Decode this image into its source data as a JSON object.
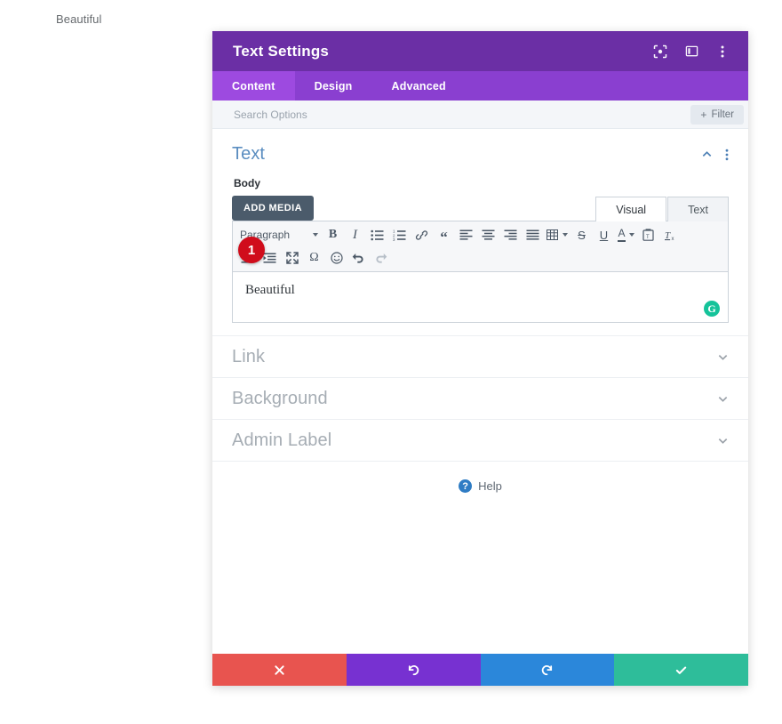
{
  "page": {
    "background_text": "Beautiful"
  },
  "modal": {
    "title": "Text Settings",
    "header_icons": [
      {
        "name": "focus-icon"
      },
      {
        "name": "layout-panel-icon"
      },
      {
        "name": "more-vertical-icon"
      }
    ],
    "tabs": [
      {
        "label": "Content",
        "active": true
      },
      {
        "label": "Design",
        "active": false
      },
      {
        "label": "Advanced",
        "active": false
      }
    ],
    "search": {
      "placeholder": "Search Options",
      "value": ""
    },
    "filter_button": {
      "label": "Filter",
      "plus": "+"
    },
    "section_text": {
      "title": "Text",
      "field_label": "Body",
      "add_media_label": "ADD MEDIA",
      "editor_tabs": [
        {
          "label": "Visual",
          "active": true
        },
        {
          "label": "Text",
          "active": false
        }
      ],
      "toolbar": {
        "format_select": "Paragraph",
        "row1": [
          {
            "name": "bold-icon",
            "glyph": "B"
          },
          {
            "name": "italic-icon",
            "glyph": "I"
          },
          {
            "name": "bulleted-list-icon",
            "glyph": ""
          },
          {
            "name": "numbered-list-icon",
            "glyph": ""
          },
          {
            "name": "link-icon",
            "glyph": ""
          },
          {
            "name": "blockquote-icon",
            "glyph": "“"
          },
          {
            "name": "align-left-icon",
            "glyph": ""
          },
          {
            "name": "align-center-icon",
            "glyph": ""
          },
          {
            "name": "align-right-icon",
            "glyph": ""
          },
          {
            "name": "align-justify-icon",
            "glyph": ""
          },
          {
            "name": "table-icon",
            "glyph": ""
          },
          {
            "name": "strikethrough-icon",
            "glyph": "S"
          },
          {
            "name": "underline-icon",
            "glyph": "U"
          },
          {
            "name": "text-color-icon",
            "glyph": "A"
          },
          {
            "name": "paste-as-text-icon",
            "glyph": ""
          },
          {
            "name": "clear-formatting-icon",
            "glyph": ""
          }
        ],
        "row2": [
          {
            "name": "decrease-indent-icon",
            "glyph": ""
          },
          {
            "name": "increase-indent-icon",
            "glyph": ""
          },
          {
            "name": "fullscreen-icon",
            "glyph": ""
          },
          {
            "name": "special-character-icon",
            "glyph": "Ω"
          },
          {
            "name": "emoji-icon",
            "glyph": "☺"
          },
          {
            "name": "undo-icon",
            "glyph": ""
          },
          {
            "name": "redo-icon",
            "glyph": "",
            "disabled": true
          }
        ]
      },
      "editor_content": "Beautiful",
      "grammarly_badge": "G"
    },
    "collapsed_sections": [
      {
        "title": "Link"
      },
      {
        "title": "Background"
      },
      {
        "title": "Admin Label"
      }
    ],
    "help": {
      "label": "Help",
      "icon_glyph": "?"
    },
    "footer_buttons": [
      {
        "name": "cancel-button",
        "icon": "close-icon",
        "color": "#e8544f"
      },
      {
        "name": "undo-button",
        "icon": "undo-icon",
        "color": "#7731d1"
      },
      {
        "name": "redo-button",
        "icon": "redo-icon",
        "color": "#2b87da"
      },
      {
        "name": "save-button",
        "icon": "check-icon",
        "color": "#2ebd9a"
      }
    ]
  },
  "annotation": {
    "step_number": "1"
  }
}
